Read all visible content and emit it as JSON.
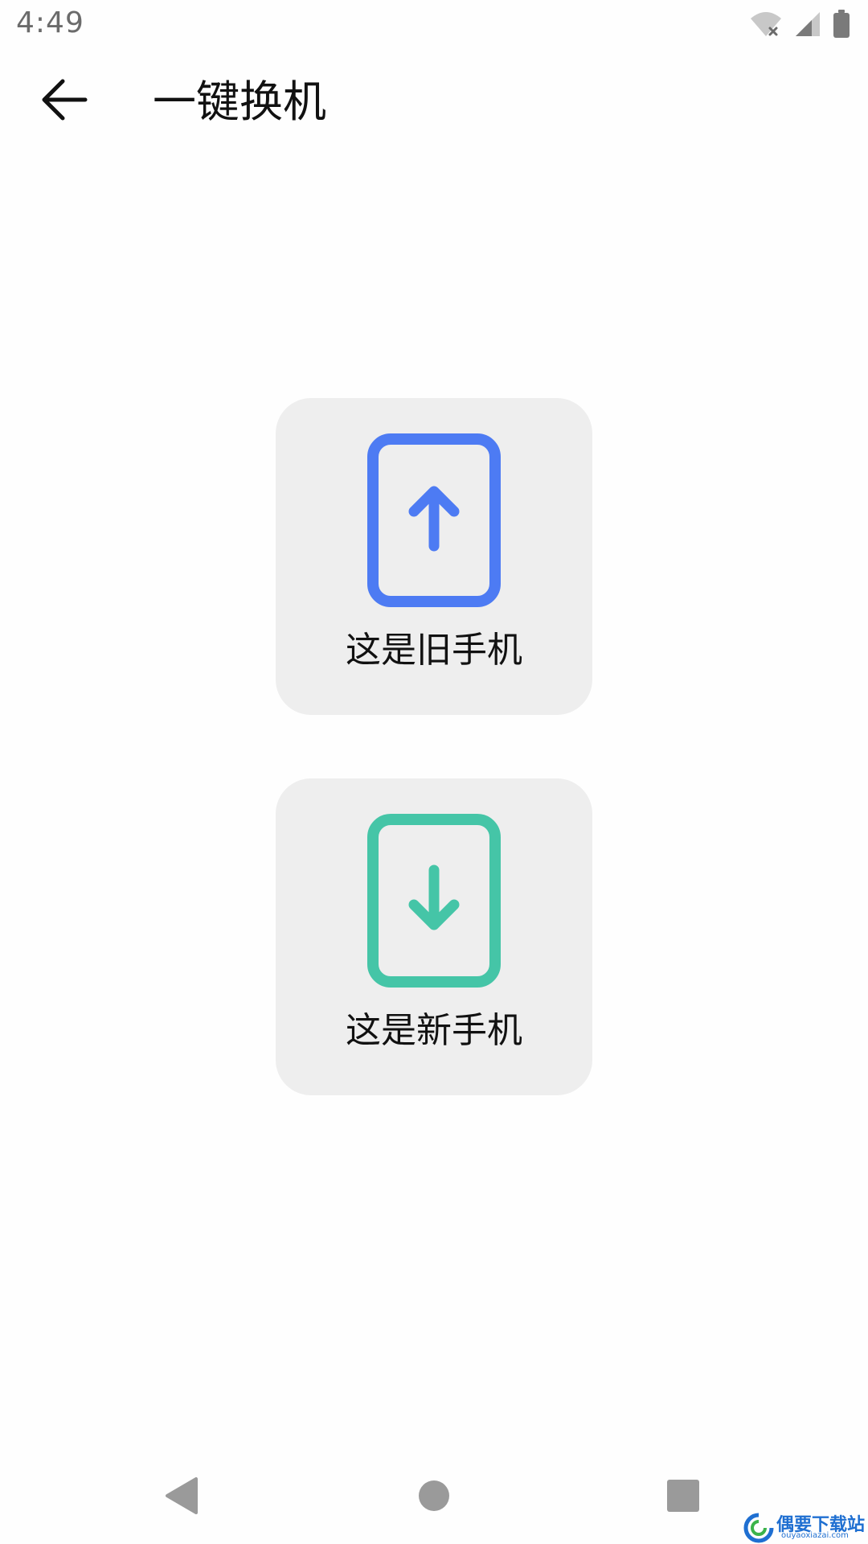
{
  "status_bar": {
    "time": "4:49",
    "icons": [
      "wifi-off-icon",
      "signal-icon",
      "battery-icon"
    ]
  },
  "toolbar": {
    "back_icon": "arrow-left-icon",
    "title": "一键换机"
  },
  "options": [
    {
      "label": "这是旧手机",
      "icon": "phone-upload-icon",
      "color": "#4d7bf3"
    },
    {
      "label": "这是新手机",
      "icon": "phone-download-icon",
      "color": "#45c5a7"
    }
  ],
  "nav_bar": {
    "icons": [
      "nav-back-icon",
      "nav-home-icon",
      "nav-recents-icon"
    ],
    "color": "#9a9a9a"
  },
  "watermark": {
    "title": "偶要下载站",
    "subtitle": "ouyaoxiazai.com"
  }
}
